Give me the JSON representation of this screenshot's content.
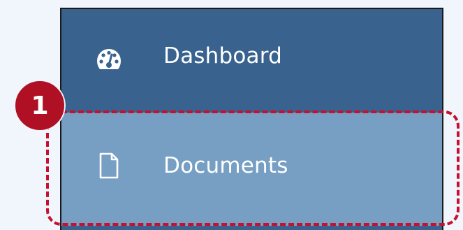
{
  "sidebar": {
    "items": [
      {
        "label": "Dashboard",
        "icon": "dashboard-gauge-icon",
        "selected": false
      },
      {
        "label": "Documents",
        "icon": "document-icon",
        "selected": true
      }
    ]
  },
  "annotation": {
    "step_number": "1"
  },
  "colors": {
    "sidebar_bg": "#39628f",
    "selected_bg": "#769fc3",
    "highlight": "#c8102e",
    "badge": "#b01024",
    "page_bg": "#f0f6fb"
  }
}
